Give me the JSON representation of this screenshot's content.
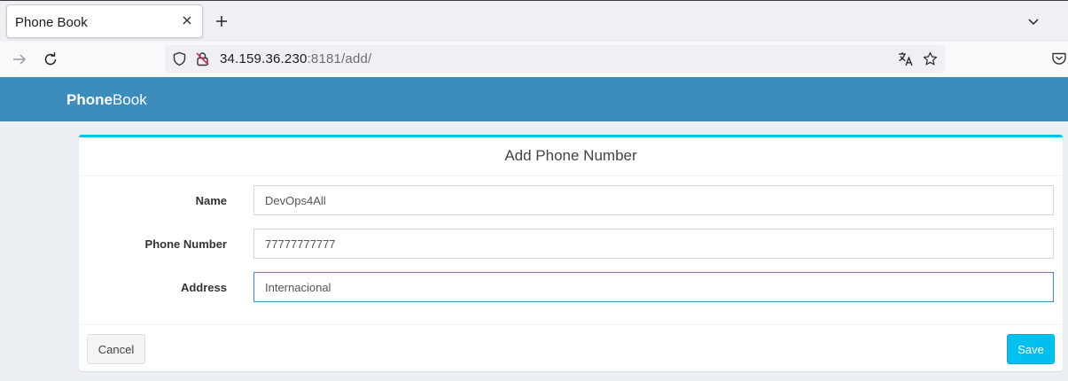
{
  "browser": {
    "tab_title": "Phone Book",
    "url_host": "34.159.36.230",
    "url_rest": ":8181/add/"
  },
  "app": {
    "brand_bold": "Phone",
    "brand_rest": "Book"
  },
  "form": {
    "title": "Add Phone Number",
    "fields": [
      {
        "label": "Name",
        "value": "DevOps4All"
      },
      {
        "label": "Phone Number",
        "value": "77777777777"
      },
      {
        "label": "Address",
        "value": "Internacional"
      }
    ],
    "cancel_label": "Cancel",
    "save_label": "Save"
  },
  "colors": {
    "header": "#3c8dbc",
    "box_accent": "#00c0ef",
    "save_button": "#00c0ef"
  }
}
